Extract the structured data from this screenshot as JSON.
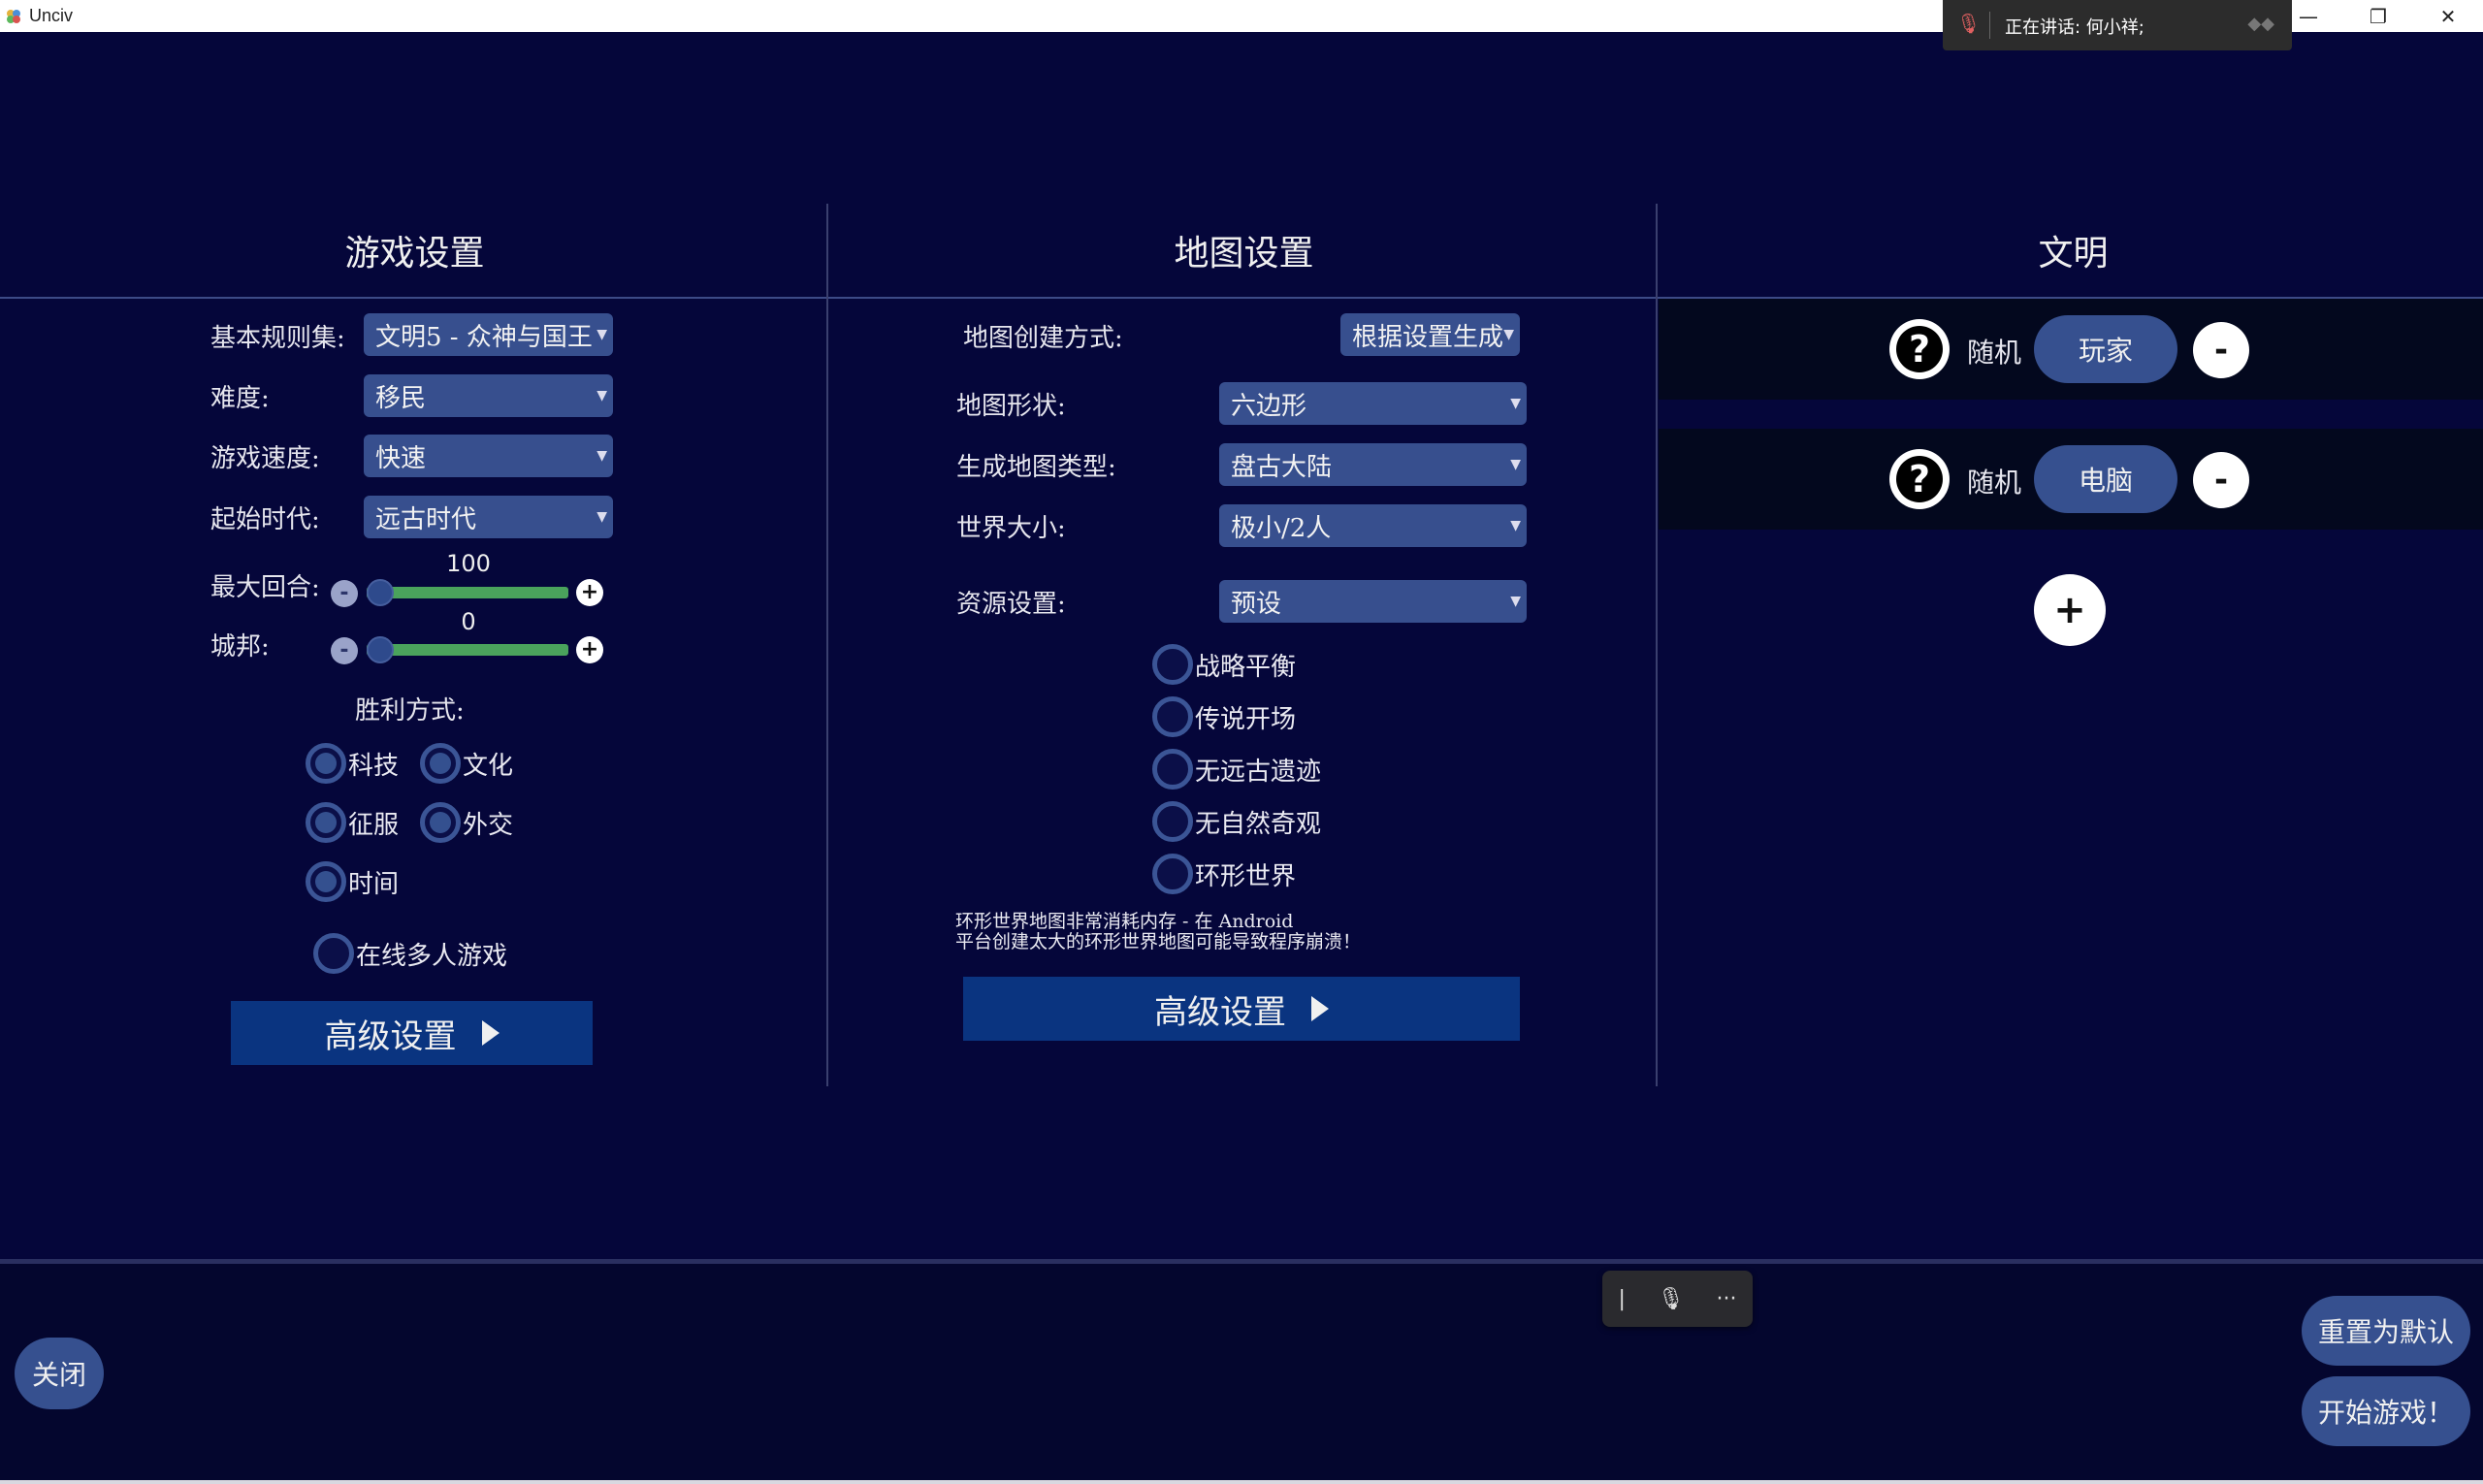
{
  "window": {
    "title": "Unciv",
    "minimize": "—",
    "restore": "❐",
    "close": "✕"
  },
  "call_notice": {
    "label": "正在讲话:  何小祥;"
  },
  "columns": {
    "game": "游戏设置",
    "map": "地图设置",
    "civ": "文明"
  },
  "game_settings": {
    "ruleset_label": "基本规则集:",
    "ruleset_value": "文明5 - 众神与国王",
    "difficulty_label": "难度:",
    "difficulty_value": "移民",
    "speed_label": "游戏速度:",
    "speed_value": "快速",
    "era_label": "起始时代:",
    "era_value": "远古时代",
    "max_turns_label": "最大回合:",
    "max_turns_value": "100",
    "city_states_label": "城邦:",
    "city_states_value": "0",
    "victory_label": "胜利方式:",
    "victory": {
      "science": "科技",
      "culture": "文化",
      "domination": "征服",
      "diplomatic": "外交",
      "time": "时间"
    },
    "online_multiplayer": "在线多人游戏",
    "advanced_button": "高级设置"
  },
  "map_settings": {
    "creation_label": "地图创建方式:",
    "creation_value": "根据设置生成",
    "shape_label": "地图形状:",
    "shape_value": "六边形",
    "type_label": "生成地图类型:",
    "type_value": "盘古大陆",
    "size_label": "世界大小:",
    "size_value": "极小/2人",
    "resource_label": "资源设置:",
    "resource_value": "预设",
    "options": {
      "strategic_balance": "战略平衡",
      "legendary_start": "传说开场",
      "no_ruins": "无远古遗迹",
      "no_wonders": "无自然奇观",
      "world_wrap": "环形世界"
    },
    "warning_line1": "环形世界地图非常消耗内存 - 在 Android",
    "warning_line2": "平台创建太大的环形世界地图可能导致程序崩溃！",
    "advanced_button": "高级设置"
  },
  "civs": {
    "players": [
      {
        "civ": "随机",
        "type": "玩家"
      },
      {
        "civ": "随机",
        "type": "电脑"
      }
    ],
    "remove_label": "-",
    "add_label": "+",
    "question_mark": "?"
  },
  "bottom": {
    "close": "关闭",
    "reset": "重置为默认",
    "start": "开始游戏！"
  },
  "floating_toolbar": {
    "bar": "|",
    "mic": "🎙",
    "more": "···"
  },
  "colors": {
    "background": "#05063a",
    "control": "#374f8e",
    "advanced_button": "#0a3480",
    "slider_fill": "#4aa35c"
  },
  "state": {
    "max_turns_value": 100,
    "city_states_value": 0
  }
}
